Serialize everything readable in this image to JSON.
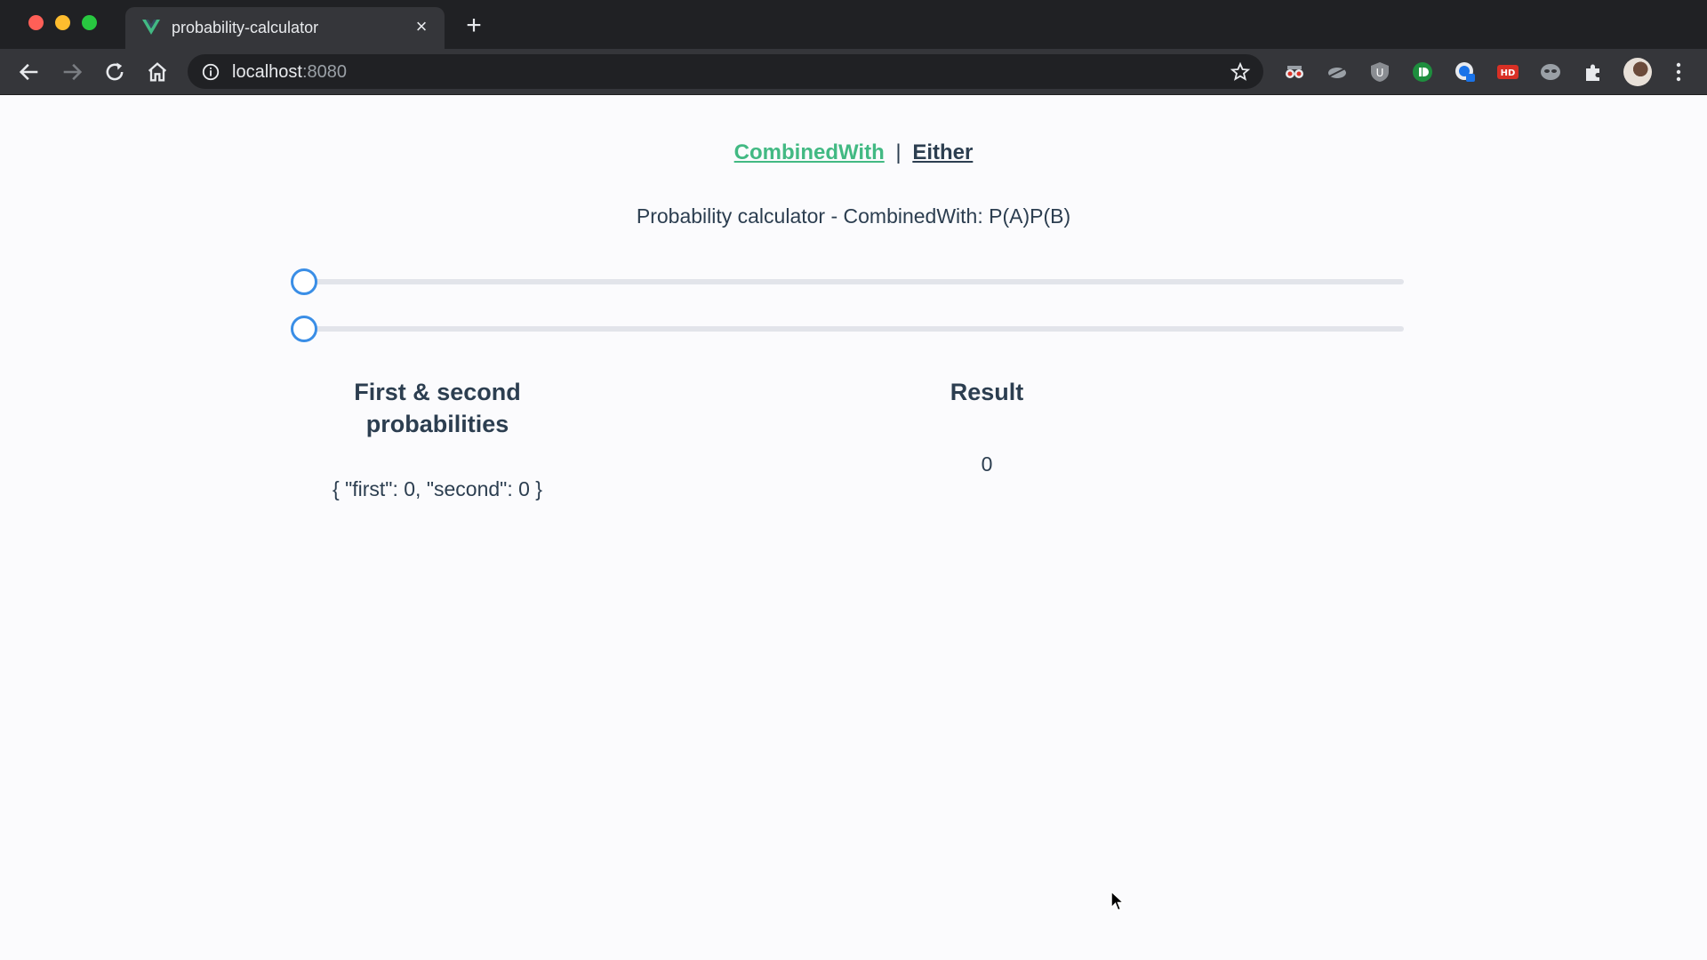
{
  "browser": {
    "tab_title": "probability-calculator",
    "url_host": "localhost",
    "url_port": ":8080",
    "extensions": [
      "spy-extension-icon",
      "cloud-extension-icon",
      "ublock-extension-icon",
      "green-extension-icon",
      "lock-extension-icon",
      "hd-extension-icon",
      "mask-extension-icon",
      "puzzle-icon"
    ]
  },
  "nav": {
    "link_combined": "CombinedWith",
    "separator": "|",
    "link_either": "Either"
  },
  "page": {
    "heading": "Probability calculator - CombinedWith: P(A)P(B)",
    "left_title": "First & second probabilities",
    "left_value": "{ \"first\": 0, \"second\": 0 }",
    "right_title": "Result",
    "right_value": "0"
  },
  "sliders": {
    "first_value": 0,
    "second_value": 0
  },
  "colors": {
    "accent_green": "#42b983",
    "text": "#2c3e50",
    "slider_blue": "#3a8ee6"
  }
}
